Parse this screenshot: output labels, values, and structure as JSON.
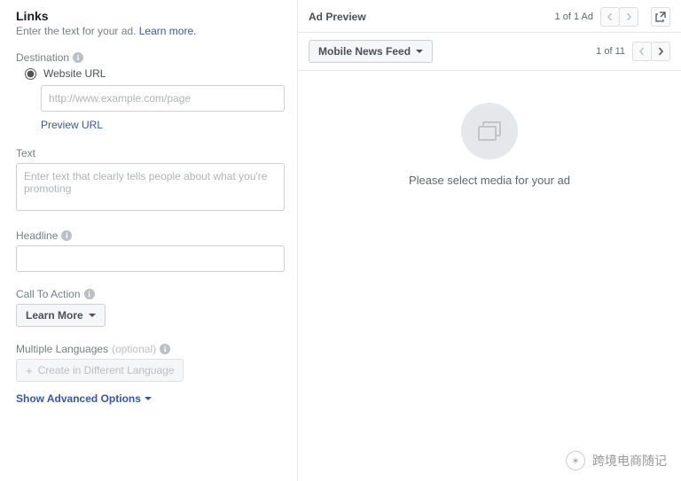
{
  "links": {
    "title": "Links",
    "subtitle": "Enter the text for your ad.",
    "learn_more": "Learn more."
  },
  "destination": {
    "label": "Destination",
    "website_url_label": "Website URL",
    "placeholder": "http://www.example.com/page",
    "preview_url": "Preview URL"
  },
  "text": {
    "label": "Text",
    "placeholder": "Enter text that clearly tells people about what you're promoting"
  },
  "headline": {
    "label": "Headline"
  },
  "cta": {
    "label": "Call To Action",
    "value": "Learn More"
  },
  "languages": {
    "label": "Multiple Languages",
    "optional": "(optional)",
    "button": "Create in Different Language"
  },
  "advanced": {
    "label": "Show Advanced Options"
  },
  "preview": {
    "title": "Ad Preview",
    "pager_ad": "1 of 1 Ad",
    "feed_selector": "Mobile News Feed",
    "pager_variation": "1 of 11",
    "empty_text": "Please select media for your ad"
  },
  "watermark": {
    "text": "跨境电商随记"
  }
}
